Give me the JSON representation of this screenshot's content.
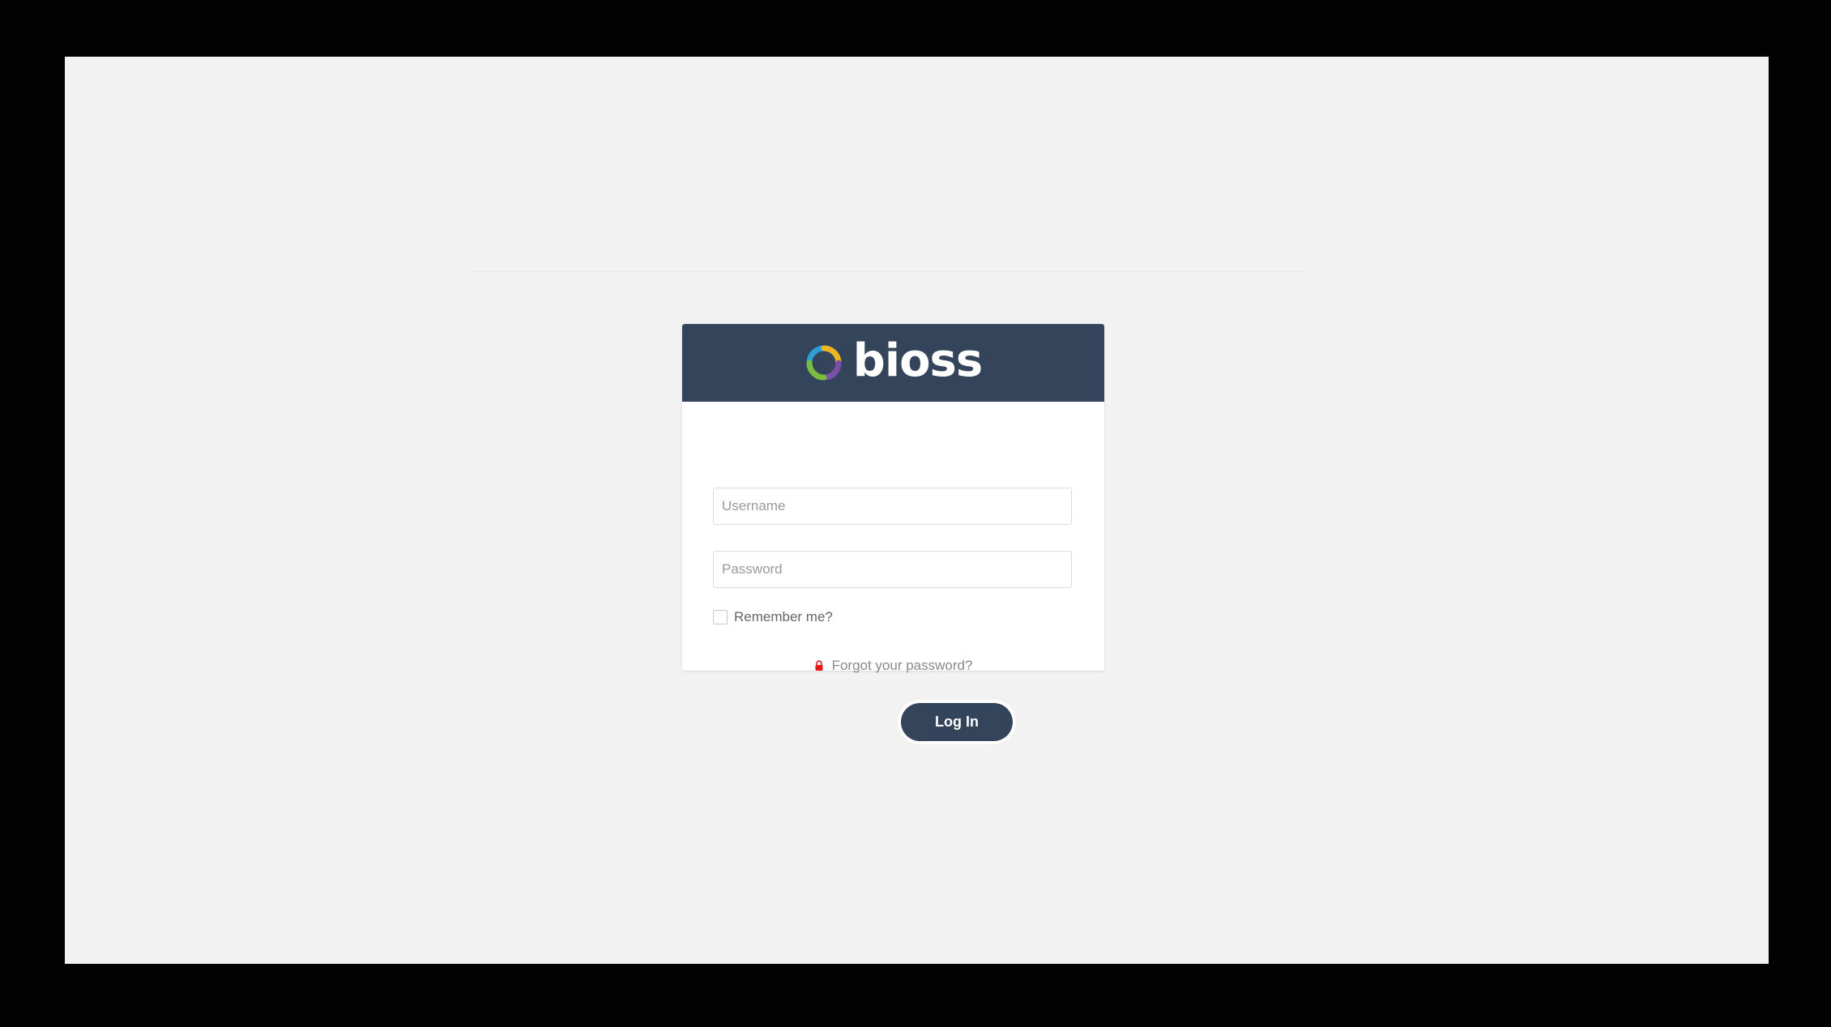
{
  "login": {
    "brand": "bioss",
    "username_placeholder": "Username",
    "password_placeholder": "Password",
    "remember_label": "Remember me?",
    "forgot_label": "Forgot your password?",
    "login_button": "Log In"
  },
  "icons": {
    "logo": "bioss-logo-icon",
    "lock": "lock-icon"
  },
  "colors": {
    "header": "#34445a",
    "background": "#f2f2f2",
    "lock": "#e31b1b"
  }
}
